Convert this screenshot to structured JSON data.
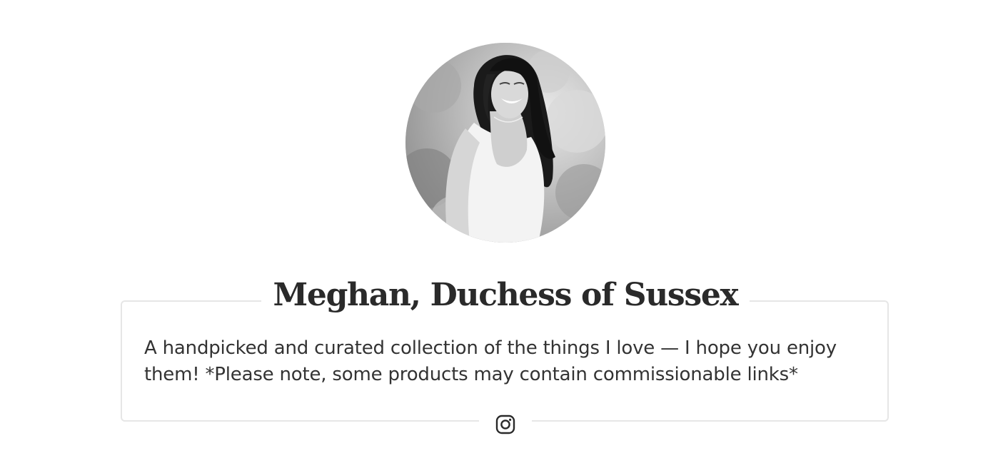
{
  "profile": {
    "name": "Meghan, Duchess of Sussex",
    "bio": "A handpicked and curated collection of the things I love — I hope you enjoy them! *Please note, some products may contain commissionable links*",
    "avatar_icon": "profile-photo",
    "avatar_style": "black-and-white photo"
  },
  "social": {
    "links": [
      {
        "icon": "instagram-icon"
      }
    ]
  },
  "colors": {
    "text": "#2a2a2a",
    "border": "#e6e6e6",
    "background": "#ffffff"
  }
}
